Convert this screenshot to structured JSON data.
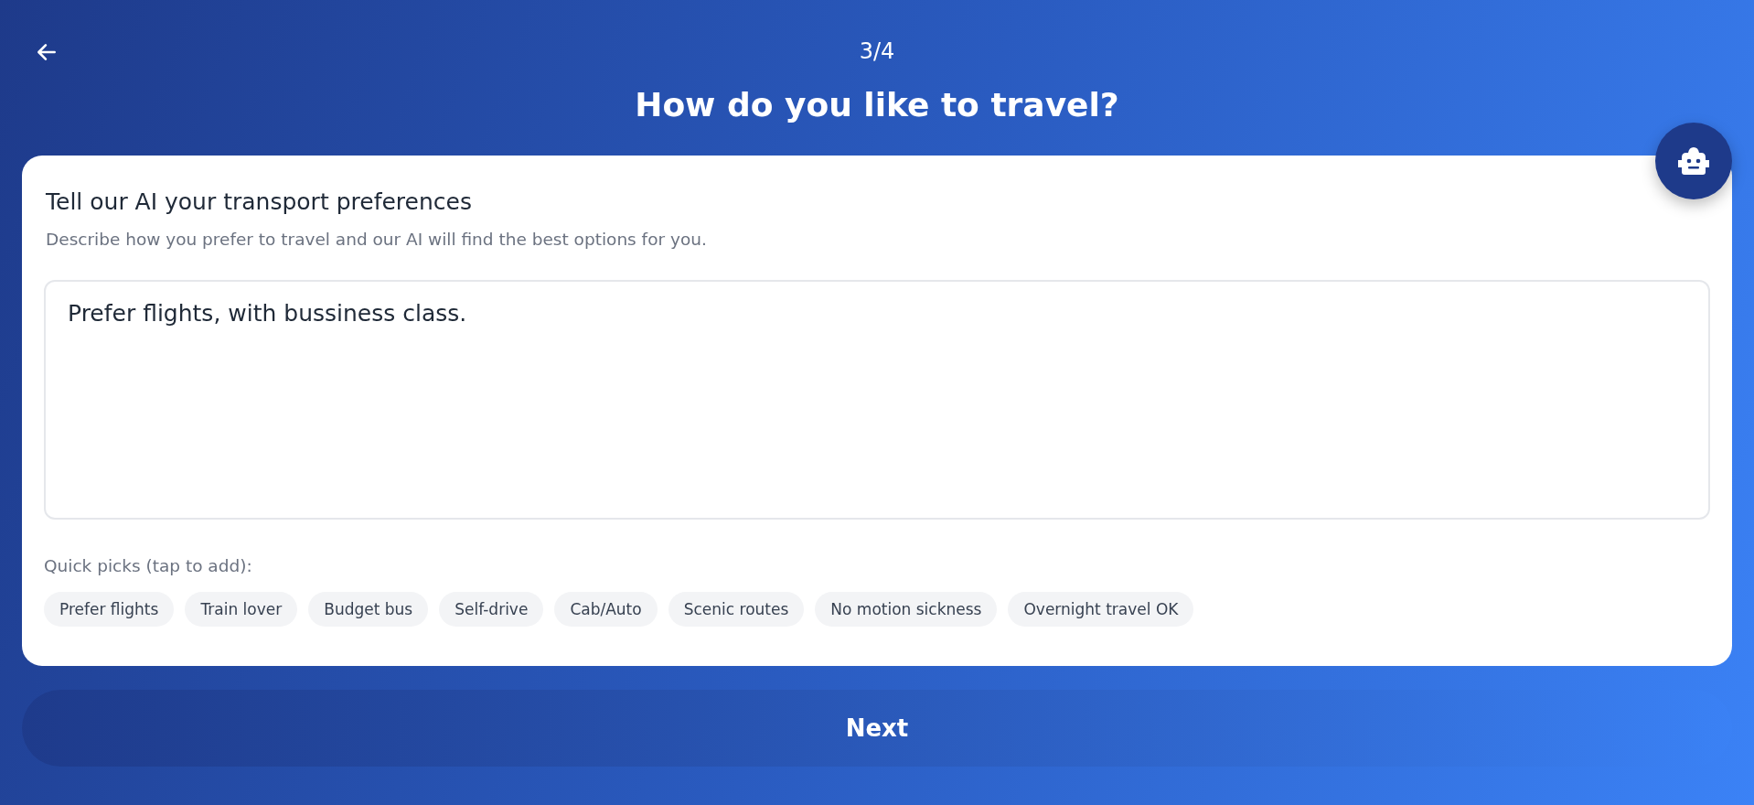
{
  "header": {
    "step": "3/4",
    "title": "How do you like to travel?"
  },
  "card": {
    "title": "Tell our AI your transport preferences",
    "subtitle": "Describe how you prefer to travel and our AI will find the best options for you.",
    "input": {
      "value": "Prefer flights, with bussiness class."
    },
    "quick_picks_label": "Quick picks (tap to add):",
    "quick_picks": [
      "Prefer flights",
      "Train lover",
      "Budget bus",
      "Self-drive",
      "Cab/Auto",
      "Scenic routes",
      "No motion sickness",
      "Overnight travel OK"
    ]
  },
  "next_button": "Next"
}
